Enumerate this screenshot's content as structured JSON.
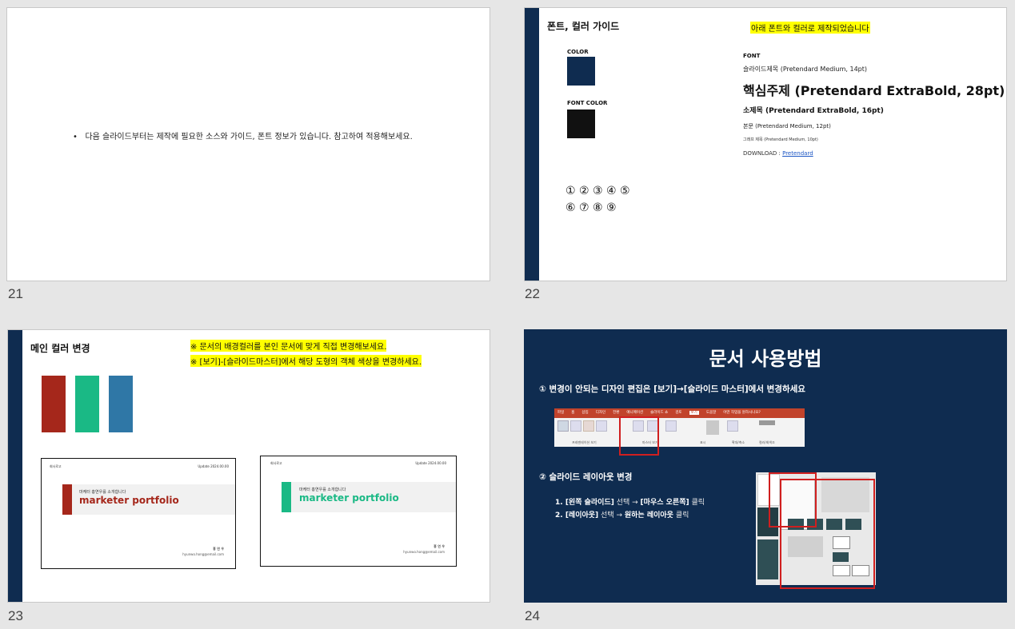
{
  "slides": [
    {
      "number": "21",
      "bullet": "다음 슬라이드부터는 제작에  필요한 소스와 가이드, 폰트 정보가 있습니다. 참고하여 적용해보세요."
    },
    {
      "number": "22",
      "title": "폰트, 컬러 가이드",
      "note": "아래 폰트와 컬러로 제작되었습니다",
      "color_label": "COLOR",
      "font_color_label": "FONT COLOR",
      "font_label": "FONT",
      "font_lines": {
        "slide_title": "슬라이드제목 (Pretendard Medium, 14pt)",
        "headline": "핵심주제 (Pretendard ExtraBold, 28pt)",
        "subtitle": "소제목 (Pretendard ExtraBold, 16pt)",
        "body": "본문 (Pretendard Medium, 12pt)",
        "caption": "그래프 제목 (Pretendard Medium, 10pt)"
      },
      "download_prefix": "DOWNLOAD : ",
      "download_link": "Pretendard",
      "numbers_row1": "① ② ③ ④ ⑤",
      "numbers_row2": "⑥ ⑦ ⑧ ⑨",
      "colors": {
        "main": "#0f2c50",
        "font": "#111111"
      }
    },
    {
      "number": "23",
      "title": "메인 컬러 변경",
      "note1": "※ 문서의 배경컬러를 본인 문서에 맞게 직접 변경해보세요.",
      "note2": "※ [보기]-[슬라이드마스터]에서 해당 도형의 객체 색상을 변경하세요.",
      "swatches": [
        "#a5271b",
        "#1ab985",
        "#2f77a6"
      ],
      "cards": [
        {
          "top_left": "회사로고",
          "top_right": "Update 2024.00.00",
          "small": "마케터 홍연우를 소개합니다",
          "title": "marketer portfolio",
          "name": "홍 연 우",
          "email": "hyunwo.hong@email.com",
          "accent": "#a5271b"
        },
        {
          "top_left": "회사로고",
          "top_right": "Update 2024.00.00",
          "small": "마케터 홍연우를 소개합니다",
          "title": "marketer portfolio",
          "name": "홍 연 우",
          "email": "hyunwo.hong@email.com",
          "accent": "#1ab985"
        }
      ]
    },
    {
      "number": "24",
      "title": "문서 사용방법",
      "step1": "① 변경이 안되는 디자인 편집은 [보기]→[슬라이드 마스터]에서 변경하세요",
      "step2": "② 슬라이드 레이아웃 변경",
      "sub1_a": "1. [왼쪽 슬라이드]",
      "sub1_b": " 선택 → ",
      "sub1_c": "[마우스 오른쪽]",
      "sub1_d": " 클릭",
      "sub2_a": "2. [레이아웃]",
      "sub2_b": " 선택 → ",
      "sub2_c": "원하는 레이아웃",
      "sub2_d": " 클릭",
      "ribbon_tabs": [
        "파일",
        "홈",
        "삽입",
        "디자인",
        "전환",
        "애니메이션",
        "슬라이드 쇼",
        "검토",
        "보기",
        "도움말",
        "어떤 작업을 원하시나요?"
      ],
      "ribbon_groups": [
        "프레젠테이션 보기",
        "마스터 보기",
        "표시",
        "확대/축소",
        "컬러/회색조"
      ],
      "bg_color": "#0f2c50"
    }
  ]
}
